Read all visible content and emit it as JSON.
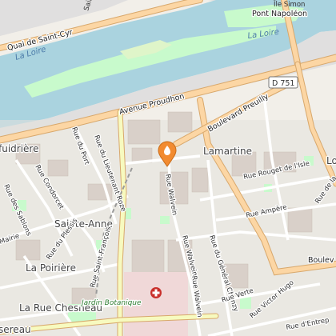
{
  "map": {
    "labels": {
      "ile_simon": "Île Simon",
      "pont_napoleon": "Pont Napoléon",
      "la_loire_right": "La Loire",
      "la_loire_left": "La Loire",
      "quai_saint_cyr": "Quai de Saint-Cyr",
      "avenue_proudhon": "Avenue Proudhon",
      "boulevard_preuilly": "Boulevard Preuilly",
      "lamartine": "Lamartine",
      "edge_lo": "Lo",
      "rue_rouget": "Rue Rouget de l'Isle",
      "rue_ampere": "Rue Ampère",
      "rue_de_la": "Rue de la",
      "boulevard_right": "Boulev",
      "rue_walvein_1": "Rue Walvein",
      "rue_walvein_2": "Rue Walvein",
      "rue_walvein_3": "Rue Walvein",
      "rue_general_chanzy": "Rue du Général Chanzy",
      "rue_verte": "Rue Verte",
      "rue_victor_hugo": "Rue Victor Hugo",
      "rue_entrep": "Rue d'Entrep",
      "rue_lieutenant_roze": "Rue du Lieutenant Roze",
      "rue_du_port": "Rue du Port",
      "rue_condorcet": "Rue Condorcet",
      "rue_sablons": "Rue des Sablons",
      "sainte_anne": "Sainte-Anne",
      "rue_plessis": "Rue du Plessis",
      "rue_saint_francois": "Rue Saint-François",
      "la_poiriere": "La Poirière",
      "mairie": "Mairie",
      "la_rue_chesneau": "La Rue Chesneau",
      "jardin_botanique": "Jardin Botanique",
      "fuidriere": "fuidrière",
      "serreau": "sereau",
      "saint_top": "Saint"
    },
    "shield": "D 751",
    "colors": {
      "water": "#aad3df",
      "park": "#c8facc",
      "primary_road": "#fcd6a4",
      "road_casing": "#d8a86c",
      "marker": "#f28b30",
      "hospital": "#c9302c"
    },
    "marker_icon": "map-pin-icon",
    "hospital_icon": "hospital-cross-icon"
  }
}
